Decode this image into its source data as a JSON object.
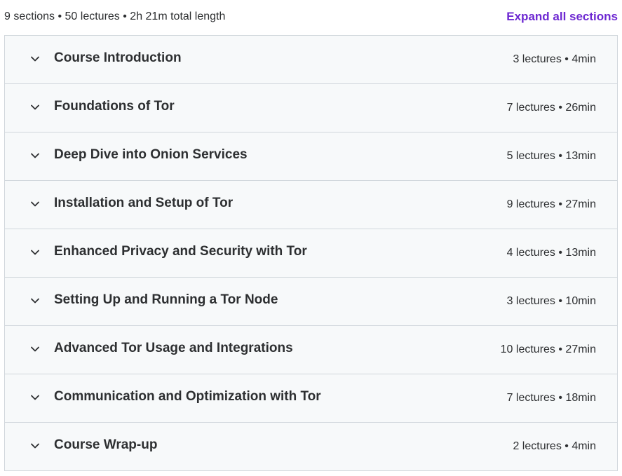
{
  "summary": {
    "text": "9 sections • 50 lectures • 2h 21m total length",
    "expand_label": "Expand all sections"
  },
  "colors": {
    "accent": "#6d28d2",
    "row_bg": "#f7f9fa",
    "border": "#d1d7dc",
    "text": "#2d2f31"
  },
  "sections": [
    {
      "title": "Course Introduction",
      "meta": "3 lectures • 4min",
      "icon": "chevron-down-icon"
    },
    {
      "title": "Foundations of Tor",
      "meta": "7 lectures • 26min",
      "icon": "chevron-down-icon"
    },
    {
      "title": "Deep Dive into Onion Services",
      "meta": "5 lectures • 13min",
      "icon": "chevron-down-icon"
    },
    {
      "title": "Installation and Setup of Tor",
      "meta": "9 lectures • 27min",
      "icon": "chevron-down-icon"
    },
    {
      "title": "Enhanced Privacy and Security with Tor",
      "meta": "4 lectures • 13min",
      "icon": "chevron-down-icon"
    },
    {
      "title": "Setting Up and Running a Tor Node",
      "meta": "3 lectures • 10min",
      "icon": "chevron-down-icon"
    },
    {
      "title": "Advanced Tor Usage and Integrations",
      "meta": "10 lectures • 27min",
      "icon": "chevron-down-icon"
    },
    {
      "title": "Communication and Optimization with Tor",
      "meta": "7 lectures • 18min",
      "icon": "chevron-down-icon"
    },
    {
      "title": "Course Wrap-up",
      "meta": "2 lectures • 4min",
      "icon": "chevron-down-icon"
    }
  ]
}
